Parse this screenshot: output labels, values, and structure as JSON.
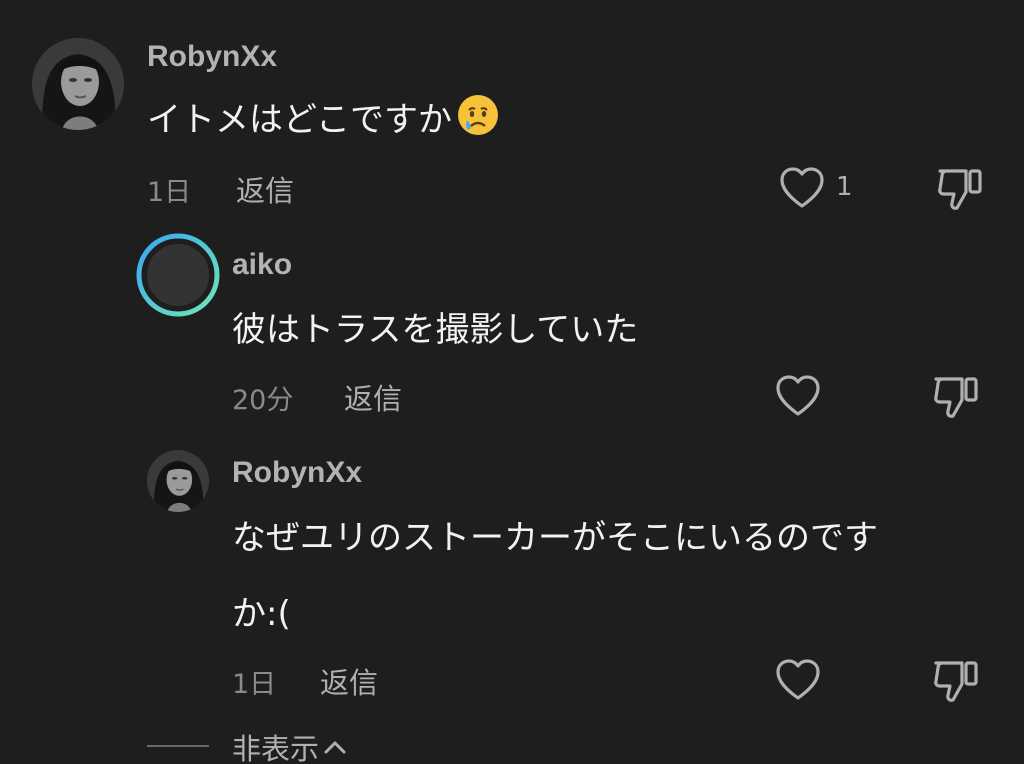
{
  "comments": [
    {
      "username": "RobynXx",
      "text": "イトメはどこですか",
      "emoji": "crying-face",
      "time": "1日",
      "reply_label": "返信",
      "like_count": "1"
    },
    {
      "username": "aiko",
      "text": "彼はトラスを撮影していた",
      "time": "20分",
      "reply_label": "返信"
    },
    {
      "username": "RobynXx",
      "text_line1": "なぜユリのストーカーがそこにいるのです",
      "text_line2": "か:(",
      "time": "1日",
      "reply_label": "返信"
    }
  ],
  "hide_replies_label": "非表示",
  "icons": {
    "like": "heart-outline-icon",
    "dislike": "thumbs-down-outline-icon",
    "collapse": "chevron-up-icon"
  },
  "colors": {
    "background": "#1e1e1e",
    "username": "#b3b3b3",
    "text": "#f2f2f2",
    "meta": "#8a8a8a",
    "story_ring_start": "#3aa6f0",
    "story_ring_end": "#6ee7b7"
  }
}
